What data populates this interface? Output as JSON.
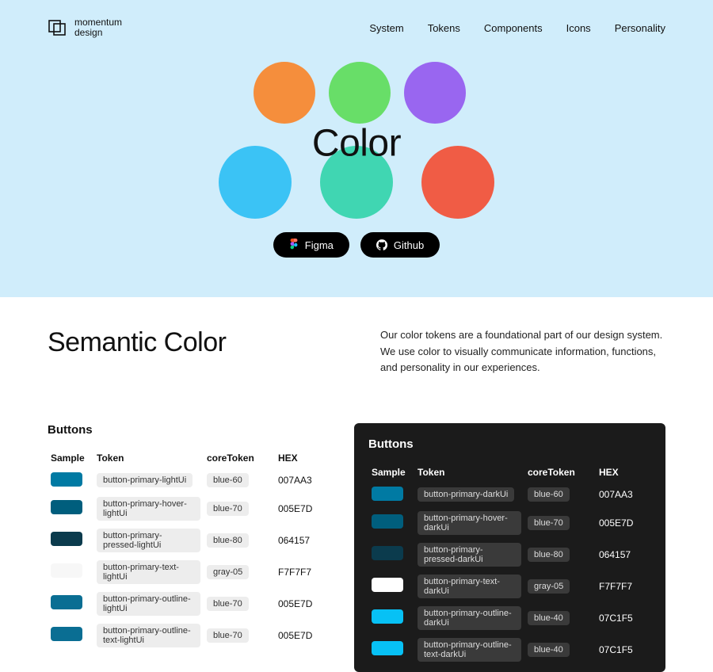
{
  "brand": {
    "line1": "momentum",
    "line2": "design"
  },
  "nav": {
    "system": "System",
    "tokens": "Tokens",
    "components": "Components",
    "icons": "Icons",
    "personality": "Personality"
  },
  "hero": {
    "title": "Color",
    "figma": "Figma",
    "github": "Github",
    "circles": {
      "orange": "#F58E3C",
      "green": "#68DE68",
      "purple": "#9966F0",
      "cyan": "#3BC3F5",
      "teal": "#40D6B2",
      "red": "#F05C45"
    }
  },
  "section": {
    "title": "Semantic Color",
    "desc": "Our color tokens are a foundational part of our design system. We use color to visually communicate information, functions, and personality in our experiences."
  },
  "tableHeaders": {
    "buttons": "Buttons",
    "sample": "Sample",
    "token": "Token",
    "core": "coreToken",
    "hex": "HEX"
  },
  "light": {
    "rows": [
      {
        "swatch": "#007AA3",
        "token": "button-primary-lightUi",
        "core": "blue-60",
        "hex": "007AA3"
      },
      {
        "swatch": "#005E7D",
        "token": "button-primary-hover-lightUi",
        "core": "blue-70",
        "hex": "005E7D"
      },
      {
        "swatch": "#0B3B4D",
        "token": "button-primary-pressed-lightUi",
        "core": "blue-80",
        "hex": "064157"
      },
      {
        "swatch": "#F7F7F7",
        "token": "button-primary-text-lightUi",
        "core": "gray-05",
        "hex": "F7F7F7"
      },
      {
        "swatch": "#0A6E93",
        "token": "button-primary-outline-lightUi",
        "core": "blue-70",
        "hex": "005E7D"
      },
      {
        "swatch": "#0A6E93",
        "token": "button-primary-outline-text-lightUi",
        "core": "blue-70",
        "hex": "005E7D"
      }
    ]
  },
  "dark": {
    "rows": [
      {
        "swatch": "#007AA3",
        "token": "button-primary-darkUi",
        "core": "blue-60",
        "hex": "007AA3"
      },
      {
        "swatch": "#005E7D",
        "token": "button-primary-hover-darkUi",
        "core": "blue-70",
        "hex": "005E7D"
      },
      {
        "swatch": "#0B3B4D",
        "token": "button-primary-pressed-darkUi",
        "core": "blue-80",
        "hex": "064157"
      },
      {
        "swatch": "#FFFFFF",
        "token": "button-primary-text-darkUi",
        "core": "gray-05",
        "hex": "F7F7F7"
      },
      {
        "swatch": "#07C1F5",
        "token": "button-primary-outline-darkUi",
        "core": "blue-40",
        "hex": "07C1F5"
      },
      {
        "swatch": "#07C1F5",
        "token": "button-primary-outline-text-darkUi",
        "core": "blue-40",
        "hex": "07C1F5"
      }
    ]
  }
}
